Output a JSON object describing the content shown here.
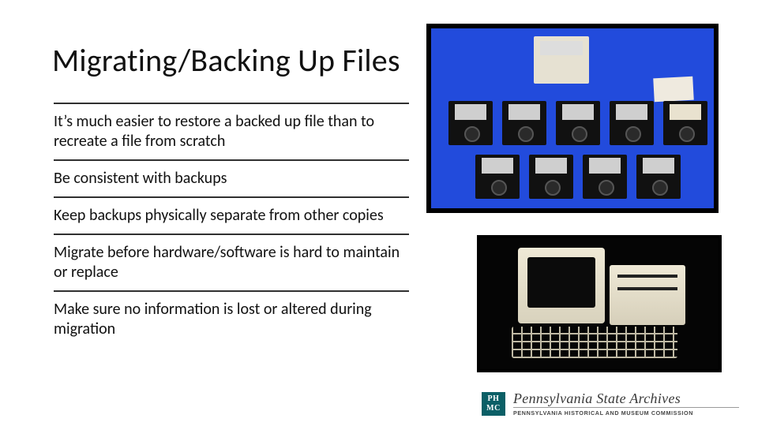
{
  "title": "Migrating/Backing Up Files",
  "bullets": [
    "It’s much easier to restore a backed up file than to recreate a file from scratch",
    "Be consistent with backups",
    "Keep backups physically separate from other copies",
    "Migrate before hardware/software is hard to maintain or replace",
    "Make sure no information is lost or altered during migration"
  ],
  "images": {
    "top_right_alt": "Assorted 3.5-inch floppy disks and a disk storage box on a blue background",
    "bottom_right_alt": "Vintage beige personal computer with monitor, disk drive, and keyboard on black background"
  },
  "footer": {
    "logo_text": "PH MC",
    "org_name": "Pennsylvania State Archives",
    "org_sub": "PENNSYLVANIA HISTORICAL AND MUSEUM COMMISSION"
  }
}
